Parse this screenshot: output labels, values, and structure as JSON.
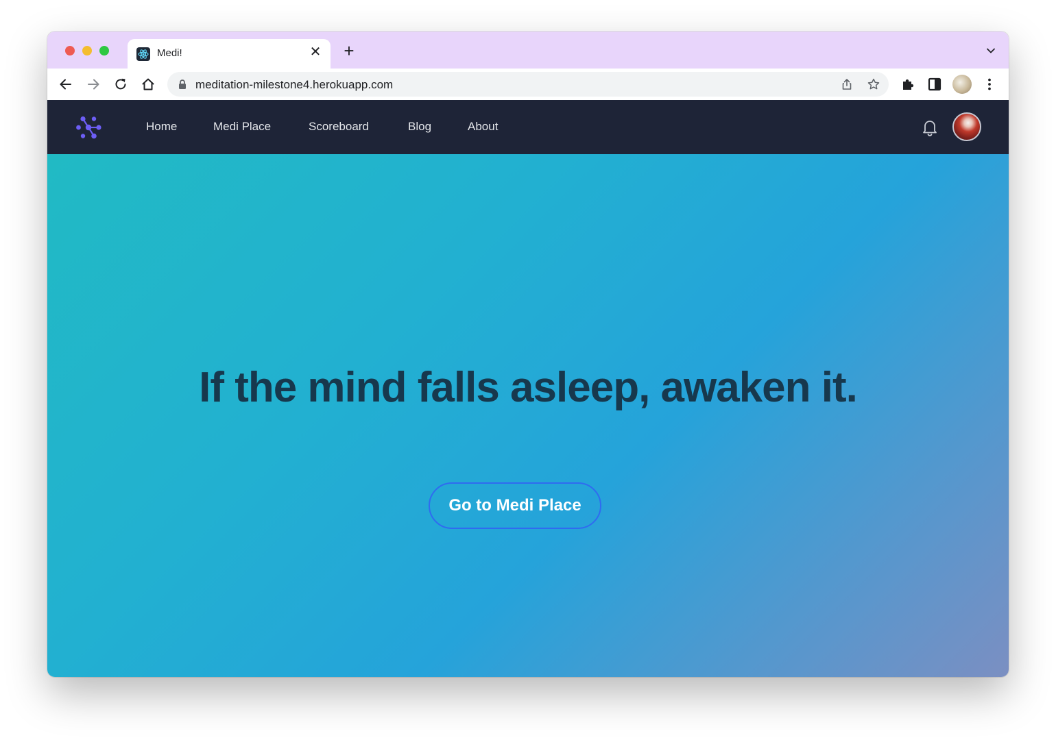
{
  "browser": {
    "tab_title": "Medi!",
    "tab_close_glyph": "✕",
    "new_tab_glyph": "+",
    "url": "meditation-milestone4.herokuapp.com",
    "icons": {
      "back": "back-arrow-icon",
      "forward": "forward-arrow-icon",
      "reload": "reload-icon",
      "home": "home-icon",
      "lock": "lock-icon",
      "share": "share-icon",
      "bookmark": "star-icon",
      "extensions": "puzzle-icon",
      "side_panel": "side-panel-icon",
      "profile": "profile-avatar",
      "menu": "kebab-menu-icon",
      "tab_search": "chevron-down-icon"
    }
  },
  "navbar": {
    "logo": "molecule-logo-icon",
    "links": [
      "Home",
      "Medi Place",
      "Scoreboard",
      "Blog",
      "About"
    ],
    "notifications_icon": "bell-icon"
  },
  "hero": {
    "headline": "If the mind falls asleep, awaken it.",
    "cta_label": "Go to Medi Place"
  },
  "colors": {
    "tabstrip": "#e8d5fb",
    "navbar": "#1e2437",
    "hero_gradient_start": "#21bac4",
    "hero_gradient_end": "#7b8fc2",
    "headline": "#17384d",
    "cta_border": "#2f6bf0",
    "logo": "#6d5ef5"
  }
}
